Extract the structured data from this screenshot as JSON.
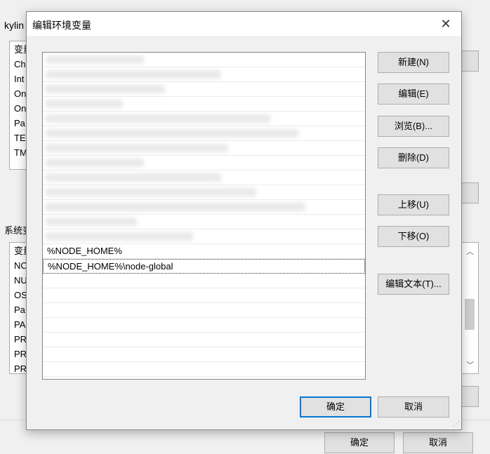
{
  "background": {
    "title_fragment": "kylin",
    "user_vars_fragments": [
      "变量",
      "Ch",
      "Int",
      "On",
      "On",
      "Pa",
      "TE",
      "TM"
    ],
    "system_label_fragment": "系统变",
    "system_vars_fragments": [
      "变量",
      "NC",
      "NU",
      "OS",
      "Pa",
      "PA",
      "PR",
      "PR",
      "PR"
    ],
    "ok_label": "确定",
    "cancel_label": "取消"
  },
  "dialog": {
    "title": "编辑环境变量",
    "close_glyph": "✕",
    "entries": [
      {
        "text": "",
        "blurred": true
      },
      {
        "text": "",
        "blurred": true
      },
      {
        "text": "",
        "blurred": true
      },
      {
        "text": "",
        "blurred": true
      },
      {
        "text": "",
        "blurred": true
      },
      {
        "text": "",
        "blurred": true
      },
      {
        "text": "",
        "blurred": true
      },
      {
        "text": "",
        "blurred": true
      },
      {
        "text": "",
        "blurred": true
      },
      {
        "text": "",
        "blurred": true
      },
      {
        "text": "",
        "blurred": true
      },
      {
        "text": "",
        "blurred": true
      },
      {
        "text": "",
        "blurred": true
      },
      {
        "text": "%NODE_HOME%",
        "blurred": false
      },
      {
        "text": "%NODE_HOME%\\node-global",
        "blurred": false,
        "focused": true
      },
      {
        "text": "",
        "blurred": false
      },
      {
        "text": "",
        "blurred": false
      },
      {
        "text": "",
        "blurred": false
      },
      {
        "text": "",
        "blurred": false
      },
      {
        "text": "",
        "blurred": false
      },
      {
        "text": "",
        "blurred": false
      },
      {
        "text": "",
        "blurred": false
      }
    ],
    "buttons": {
      "new": "新建(N)",
      "edit": "编辑(E)",
      "browse": "浏览(B)...",
      "delete": "删除(D)",
      "move_up": "上移(U)",
      "move_down": "下移(O)",
      "edit_text": "编辑文本(T)...",
      "ok": "确定",
      "cancel": "取消"
    }
  },
  "colors": {
    "accent": "#0078d7",
    "button_face": "#e1e1e1",
    "window_bg": "#f0f0f0"
  }
}
